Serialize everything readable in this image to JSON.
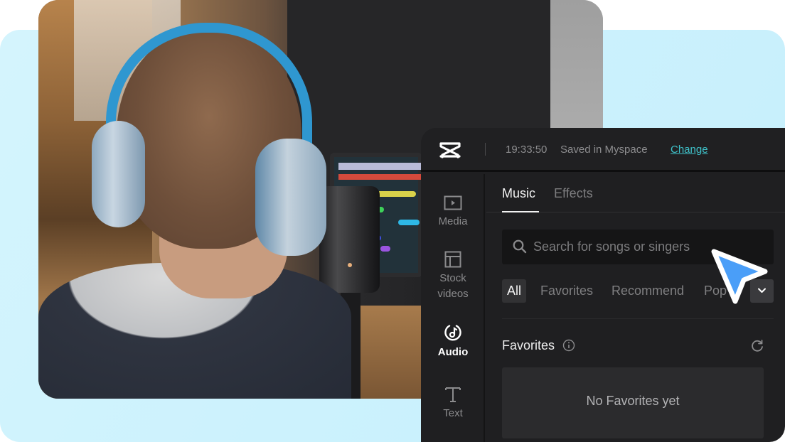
{
  "header": {
    "logo": "capcut-logo",
    "save_time": "19:33:50",
    "save_status": "Saved in Myspace",
    "change_label": "Change"
  },
  "sidebar": {
    "items": [
      {
        "label": "Media",
        "icon": "play-box-icon",
        "active": false
      },
      {
        "label": "Stock videos",
        "label_line1": "Stock",
        "label_line2": "videos",
        "icon": "layout-icon",
        "active": false
      },
      {
        "label": "Audio",
        "icon": "music-note-circle-icon",
        "active": true
      },
      {
        "label": "Text",
        "icon": "text-t-icon",
        "active": false
      }
    ]
  },
  "tabs": [
    {
      "label": "Music",
      "active": true
    },
    {
      "label": "Effects",
      "active": false
    }
  ],
  "search": {
    "placeholder": "Search for songs or singers",
    "value": ""
  },
  "filters": [
    {
      "label": "All",
      "active": true
    },
    {
      "label": "Favorites",
      "active": false
    },
    {
      "label": "Recommend",
      "active": false
    },
    {
      "label": "Pop",
      "active": false
    }
  ],
  "favorites": {
    "title": "Favorites",
    "empty_text": "No Favorites yet"
  },
  "colors": {
    "accent_link": "#3fc1c9",
    "cursor": "#4a9ef8",
    "panel_bg": "#1f1f21",
    "background_card": "#ccf2fd"
  }
}
